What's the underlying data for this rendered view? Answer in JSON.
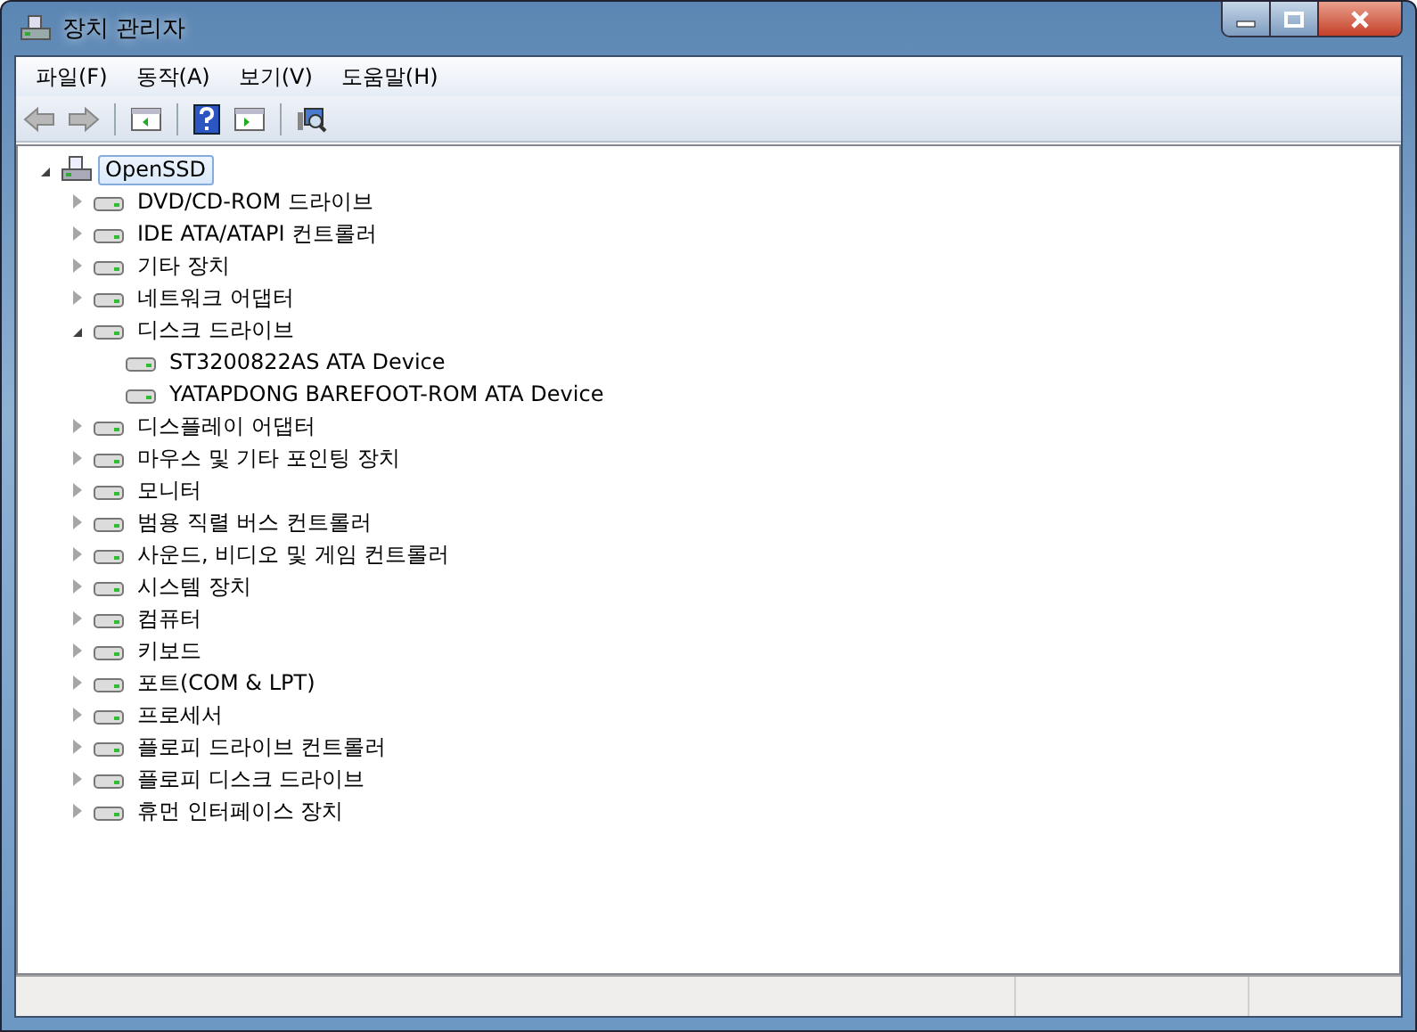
{
  "window": {
    "title": "장치 관리자"
  },
  "menu": [
    {
      "label": "파일(F)"
    },
    {
      "label": "동작(A)"
    },
    {
      "label": "보기(V)"
    },
    {
      "label": "도움말(H)"
    }
  ],
  "toolbar": [
    {
      "kind": "back",
      "disabled": true
    },
    {
      "kind": "forward",
      "disabled": true
    },
    {
      "kind": "separator"
    },
    {
      "kind": "console",
      "disabled": false
    },
    {
      "kind": "separator"
    },
    {
      "kind": "help",
      "disabled": false
    },
    {
      "kind": "pane",
      "disabled": false
    },
    {
      "kind": "separator"
    },
    {
      "kind": "scan",
      "disabled": false
    }
  ],
  "tree": {
    "label": "OpenSSD",
    "expanded": true,
    "selected": true,
    "children": [
      {
        "label": "DVD/CD-ROM 드라이브",
        "expanded": false,
        "selected": false
      },
      {
        "label": "IDE ATA/ATAPI 컨트롤러",
        "expanded": false,
        "selected": false
      },
      {
        "label": "기타 장치",
        "expanded": false,
        "selected": false
      },
      {
        "label": "네트워크 어댑터",
        "expanded": false,
        "selected": false
      },
      {
        "label": "디스크 드라이브",
        "expanded": true,
        "selected": false,
        "children": [
          {
            "label": "ST3200822AS ATA Device",
            "selected": false
          },
          {
            "label": "YATAPDONG BAREFOOT-ROM ATA Device",
            "selected": false
          }
        ]
      },
      {
        "label": "디스플레이 어댑터",
        "expanded": false,
        "selected": false
      },
      {
        "label": "마우스 및 기타 포인팅 장치",
        "expanded": false,
        "selected": false
      },
      {
        "label": "모니터",
        "expanded": false,
        "selected": false
      },
      {
        "label": "범용 직렬 버스 컨트롤러",
        "expanded": false,
        "selected": false
      },
      {
        "label": "사운드, 비디오 및 게임 컨트롤러",
        "expanded": false,
        "selected": false
      },
      {
        "label": "시스템 장치",
        "expanded": false,
        "selected": false
      },
      {
        "label": "컴퓨터",
        "expanded": false,
        "selected": false
      },
      {
        "label": "키보드",
        "expanded": false,
        "selected": false
      },
      {
        "label": "포트(COM & LPT)",
        "expanded": false,
        "selected": false
      },
      {
        "label": "프로세서",
        "expanded": false,
        "selected": false
      },
      {
        "label": "플로피 드라이브 컨트롤러",
        "expanded": false,
        "selected": false
      },
      {
        "label": "플로피 디스크 드라이브",
        "expanded": false,
        "selected": false
      },
      {
        "label": "휴먼 인터페이스 장치",
        "expanded": false,
        "selected": false
      }
    ]
  }
}
